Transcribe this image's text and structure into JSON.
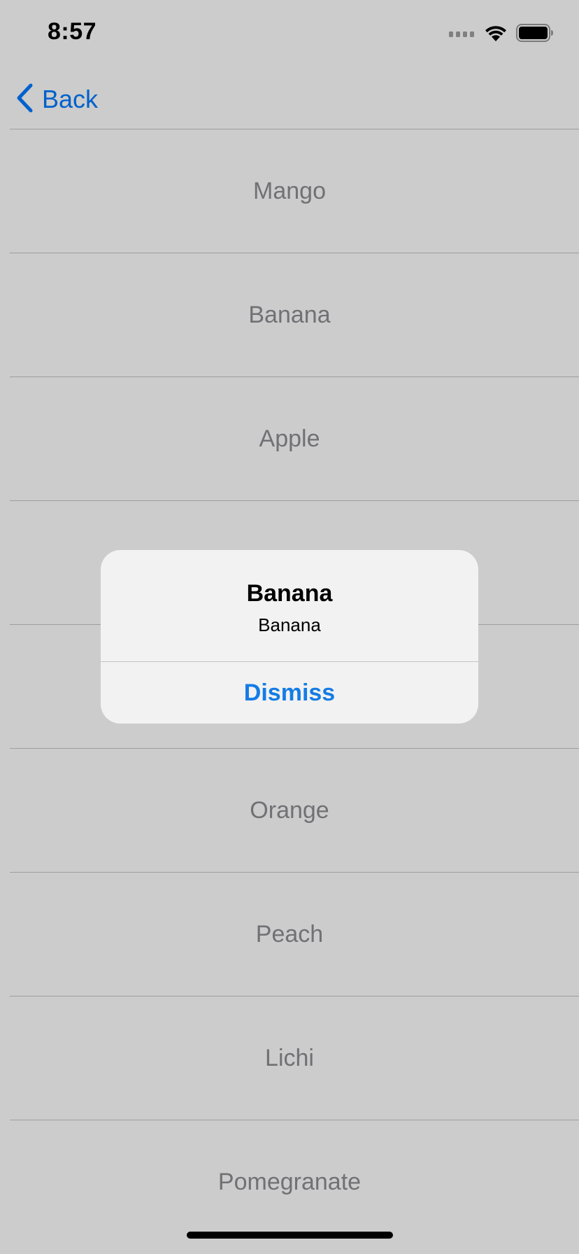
{
  "status_bar": {
    "time": "8:57",
    "icons": [
      "cellular-signal-icon",
      "wifi-icon",
      "battery-icon"
    ]
  },
  "nav": {
    "back_label": "Back",
    "back_icon": "chevron-left-icon"
  },
  "list": {
    "items": [
      {
        "label": "Mango"
      },
      {
        "label": "Banana"
      },
      {
        "label": "Apple"
      },
      {
        "label": ""
      },
      {
        "label": ""
      },
      {
        "label": "Orange"
      },
      {
        "label": "Peach"
      },
      {
        "label": "Lichi"
      },
      {
        "label": "Pomegranate"
      }
    ]
  },
  "alert": {
    "title": "Banana",
    "message": "Banana",
    "action_label": "Dismiss"
  },
  "colors": {
    "accent": "#007aff",
    "alert_action": "#147ce5",
    "row_text": "#8e8e93",
    "separator": "#c6c6c8",
    "dim_overlay": "rgba(0,0,0,0.2)"
  }
}
